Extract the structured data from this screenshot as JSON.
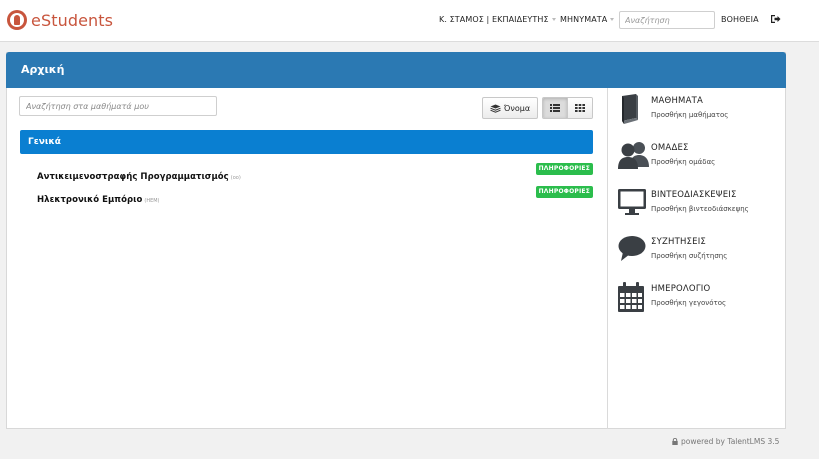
{
  "brand": {
    "name": "eStudents",
    "color": "#c8553d"
  },
  "topnav": {
    "user_label": "Κ. ΣΤΑΜΟΣ | ΕΚΠΑΙΔΕΥΤΗΣ",
    "messages_label": "ΜΗΝΥΜΑΤΑ",
    "search_placeholder": "Αναζήτηση",
    "help_label": "ΒΟΗΘΕΙΑ",
    "logout_icon": "sign-out-icon"
  },
  "panel": {
    "title": "Αρχική",
    "header_color": "#2b79b3",
    "course_search_placeholder": "Αναζήτηση στα μαθήματά μου",
    "sort_label": "Όνομα",
    "views": [
      "list-view-icon",
      "grid-view-icon"
    ],
    "active_view": "list"
  },
  "category": {
    "label": "Γενικά",
    "color": "#0a7fd1"
  },
  "courses": [
    {
      "name": "Αντικειμενοστραφής Προγραμματισμός",
      "code": "(oo)",
      "badge": "ΠΛΗΡΟΦΟΡΙΕΣ"
    },
    {
      "name": "Ηλεκτρονικό Εμπόριο",
      "code": "(HEM)",
      "badge": "ΠΛΗΡΟΦΟΡΙΕΣ"
    }
  ],
  "sidebar": [
    {
      "icon": "book-icon",
      "title": "ΜΑΘΗΜΑΤΑ",
      "subtitle": "Προσθήκη μαθήματος"
    },
    {
      "icon": "users-icon",
      "title": "ΟΜΑΔΕΣ",
      "subtitle": "Προσθήκη ομάδας"
    },
    {
      "icon": "monitor-icon",
      "title": "ΒΙΝΤΕΟΔΙΑΣΚΕΨΕΙΣ",
      "subtitle": "Προσθήκη βιντεοδιάσκεψης"
    },
    {
      "icon": "chat-bubble-icon",
      "title": "ΣΥΖΗΤΗΣΕΙΣ",
      "subtitle": "Προσθήκη συζήτησης"
    },
    {
      "icon": "calendar-icon",
      "title": "ΗΜΕΡΟΛΟΓΙΟ",
      "subtitle": "Προσθήκη γεγονότος"
    }
  ],
  "footer": {
    "text": "powered by TalentLMS 3.5"
  }
}
